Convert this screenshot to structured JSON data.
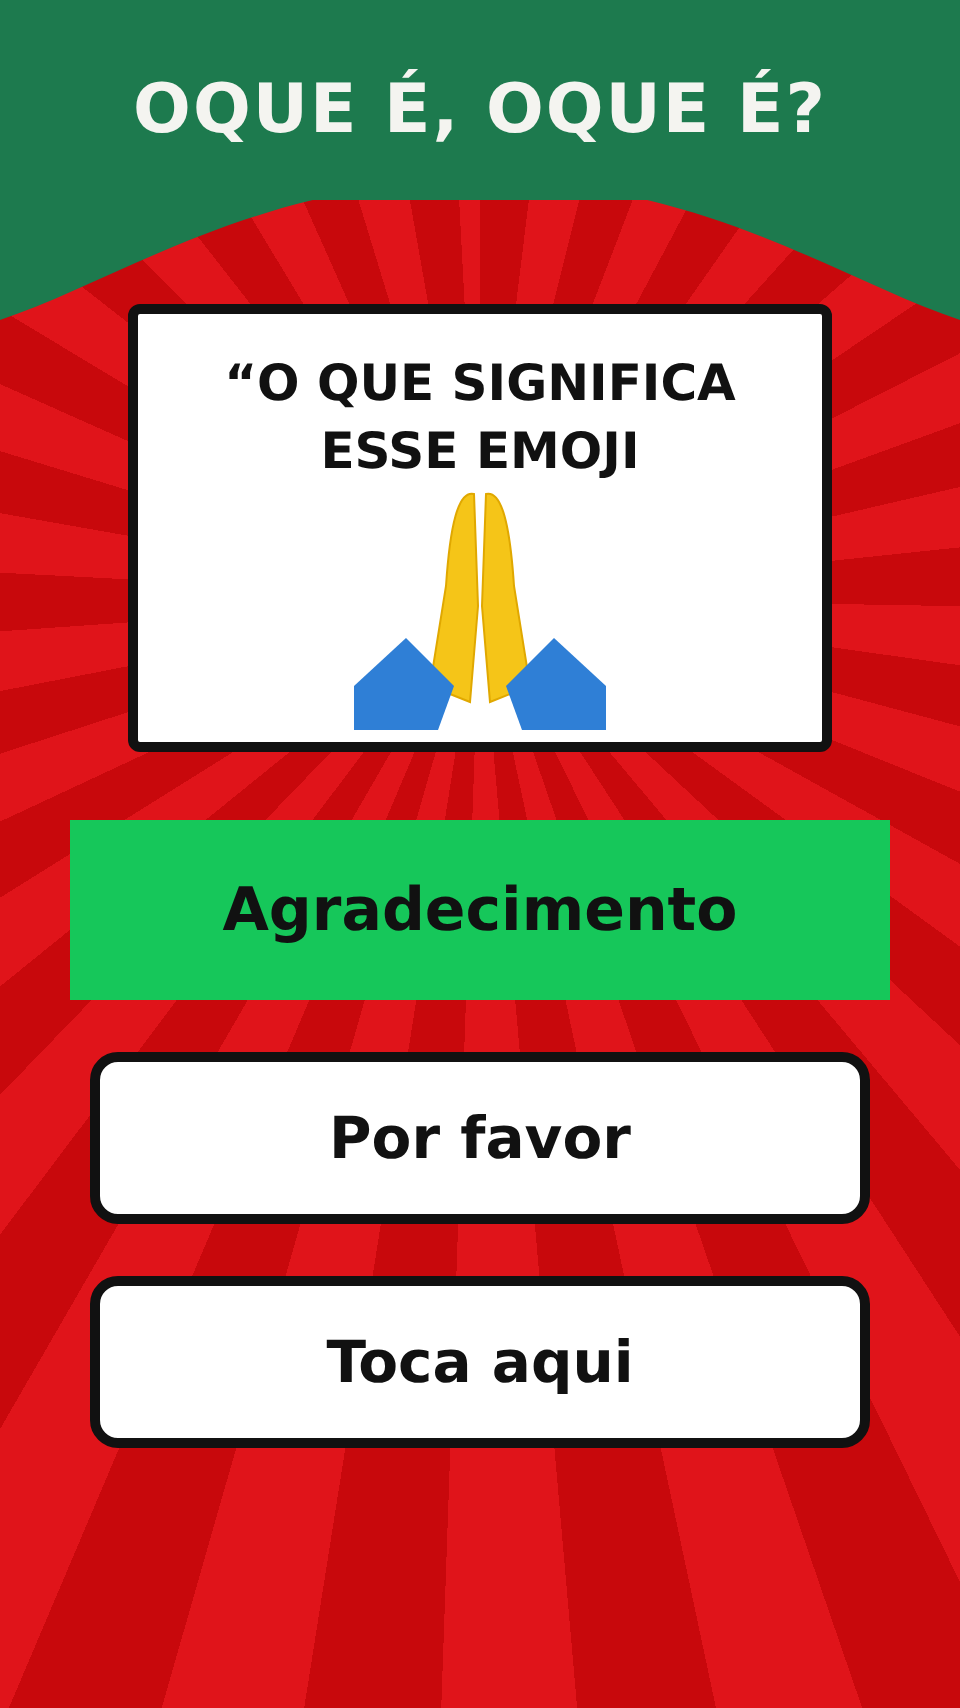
{
  "header": {
    "title": "OQUE É, OQUE É?"
  },
  "question": {
    "lines": [
      "“O QUE SIGNIFICA",
      "ESSE EMOJI"
    ]
  },
  "options": [
    {
      "label": "Agradecimento",
      "selected": true
    },
    {
      "label": "Por favor",
      "selected": false
    },
    {
      "label": "Toca aqui",
      "selected": false
    }
  ]
}
